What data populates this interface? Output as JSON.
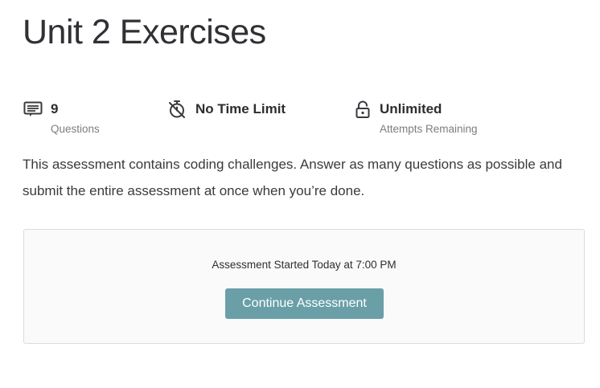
{
  "page": {
    "title": "Unit 2 Exercises"
  },
  "stats": {
    "questions": {
      "icon": "list-icon",
      "value": "9",
      "label": "Questions"
    },
    "time": {
      "icon": "stopwatch-off-icon",
      "value": "No Time Limit"
    },
    "attempts": {
      "icon": "lock-icon",
      "value": "Unlimited",
      "label": "Attempts Remaining"
    }
  },
  "description": "This assessment contains coding challenges. Answer as many questions as possible and submit the entire assessment at once when you’re done.",
  "assessment": {
    "status": "Assessment Started Today at 7:00 PM",
    "continue_label": "Continue Assessment"
  },
  "colors": {
    "button_background": "#6a9fa8",
    "card_background": "#fafafa",
    "card_border": "#dcdcdf",
    "muted_text": "#7d7d82"
  }
}
